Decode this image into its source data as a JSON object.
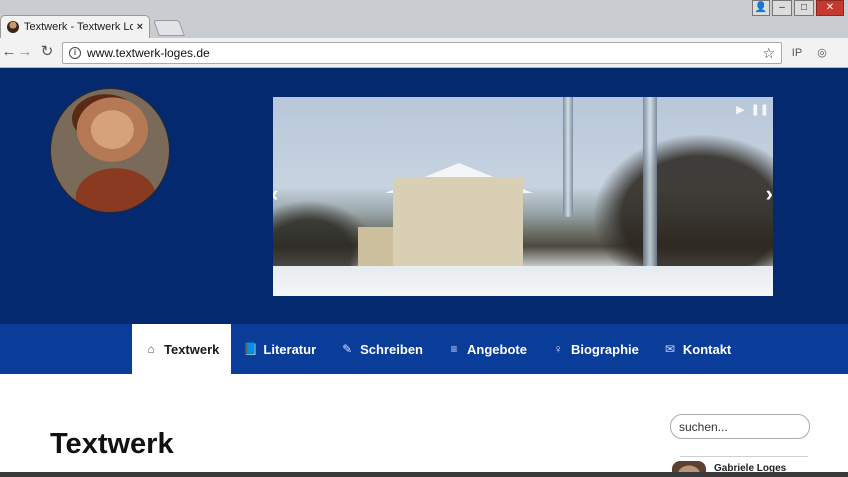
{
  "browser": {
    "tab_title": "Textwerk - Textwerk Loge",
    "tab_close": "×",
    "url": "www.textwerk-loges.de",
    "info_glyph": "i",
    "star_glyph": "☆",
    "back_glyph": "←",
    "forward_glyph": "→",
    "reload_glyph": "↻",
    "ext1_glyph": "IP",
    "ext2_glyph": "◎",
    "window_controls": {
      "user": "👤",
      "minimize": "–",
      "maximize": "□",
      "close": "✕"
    }
  },
  "slider": {
    "prev_glyph": "‹",
    "next_glyph": "›",
    "play_glyph": "▶",
    "pause_glyph": "❚❚"
  },
  "nav": {
    "items": [
      {
        "label": "Textwerk",
        "icon": "home-icon",
        "glyph": "⌂",
        "active": true
      },
      {
        "label": "Literatur",
        "icon": "book-icon",
        "glyph": "📘",
        "active": false
      },
      {
        "label": "Schreiben",
        "icon": "pencil-icon",
        "glyph": "✎",
        "active": false
      },
      {
        "label": "Angebote",
        "icon": "database-icon",
        "glyph": "≡",
        "active": false
      },
      {
        "label": "Biographie",
        "icon": "lightbulb-icon",
        "glyph": "♀",
        "active": false
      },
      {
        "label": "Kontakt",
        "icon": "envelope-icon",
        "glyph": "✉",
        "active": false
      }
    ]
  },
  "main": {
    "title": "Textwerk"
  },
  "sidebar": {
    "search_placeholder": "suchen...",
    "author_name": "Gabriele Loges"
  },
  "colors": {
    "header_bg": "#05296e",
    "nav_bg": "#0a3c9a",
    "active_tab_bg": "#ffffff"
  }
}
